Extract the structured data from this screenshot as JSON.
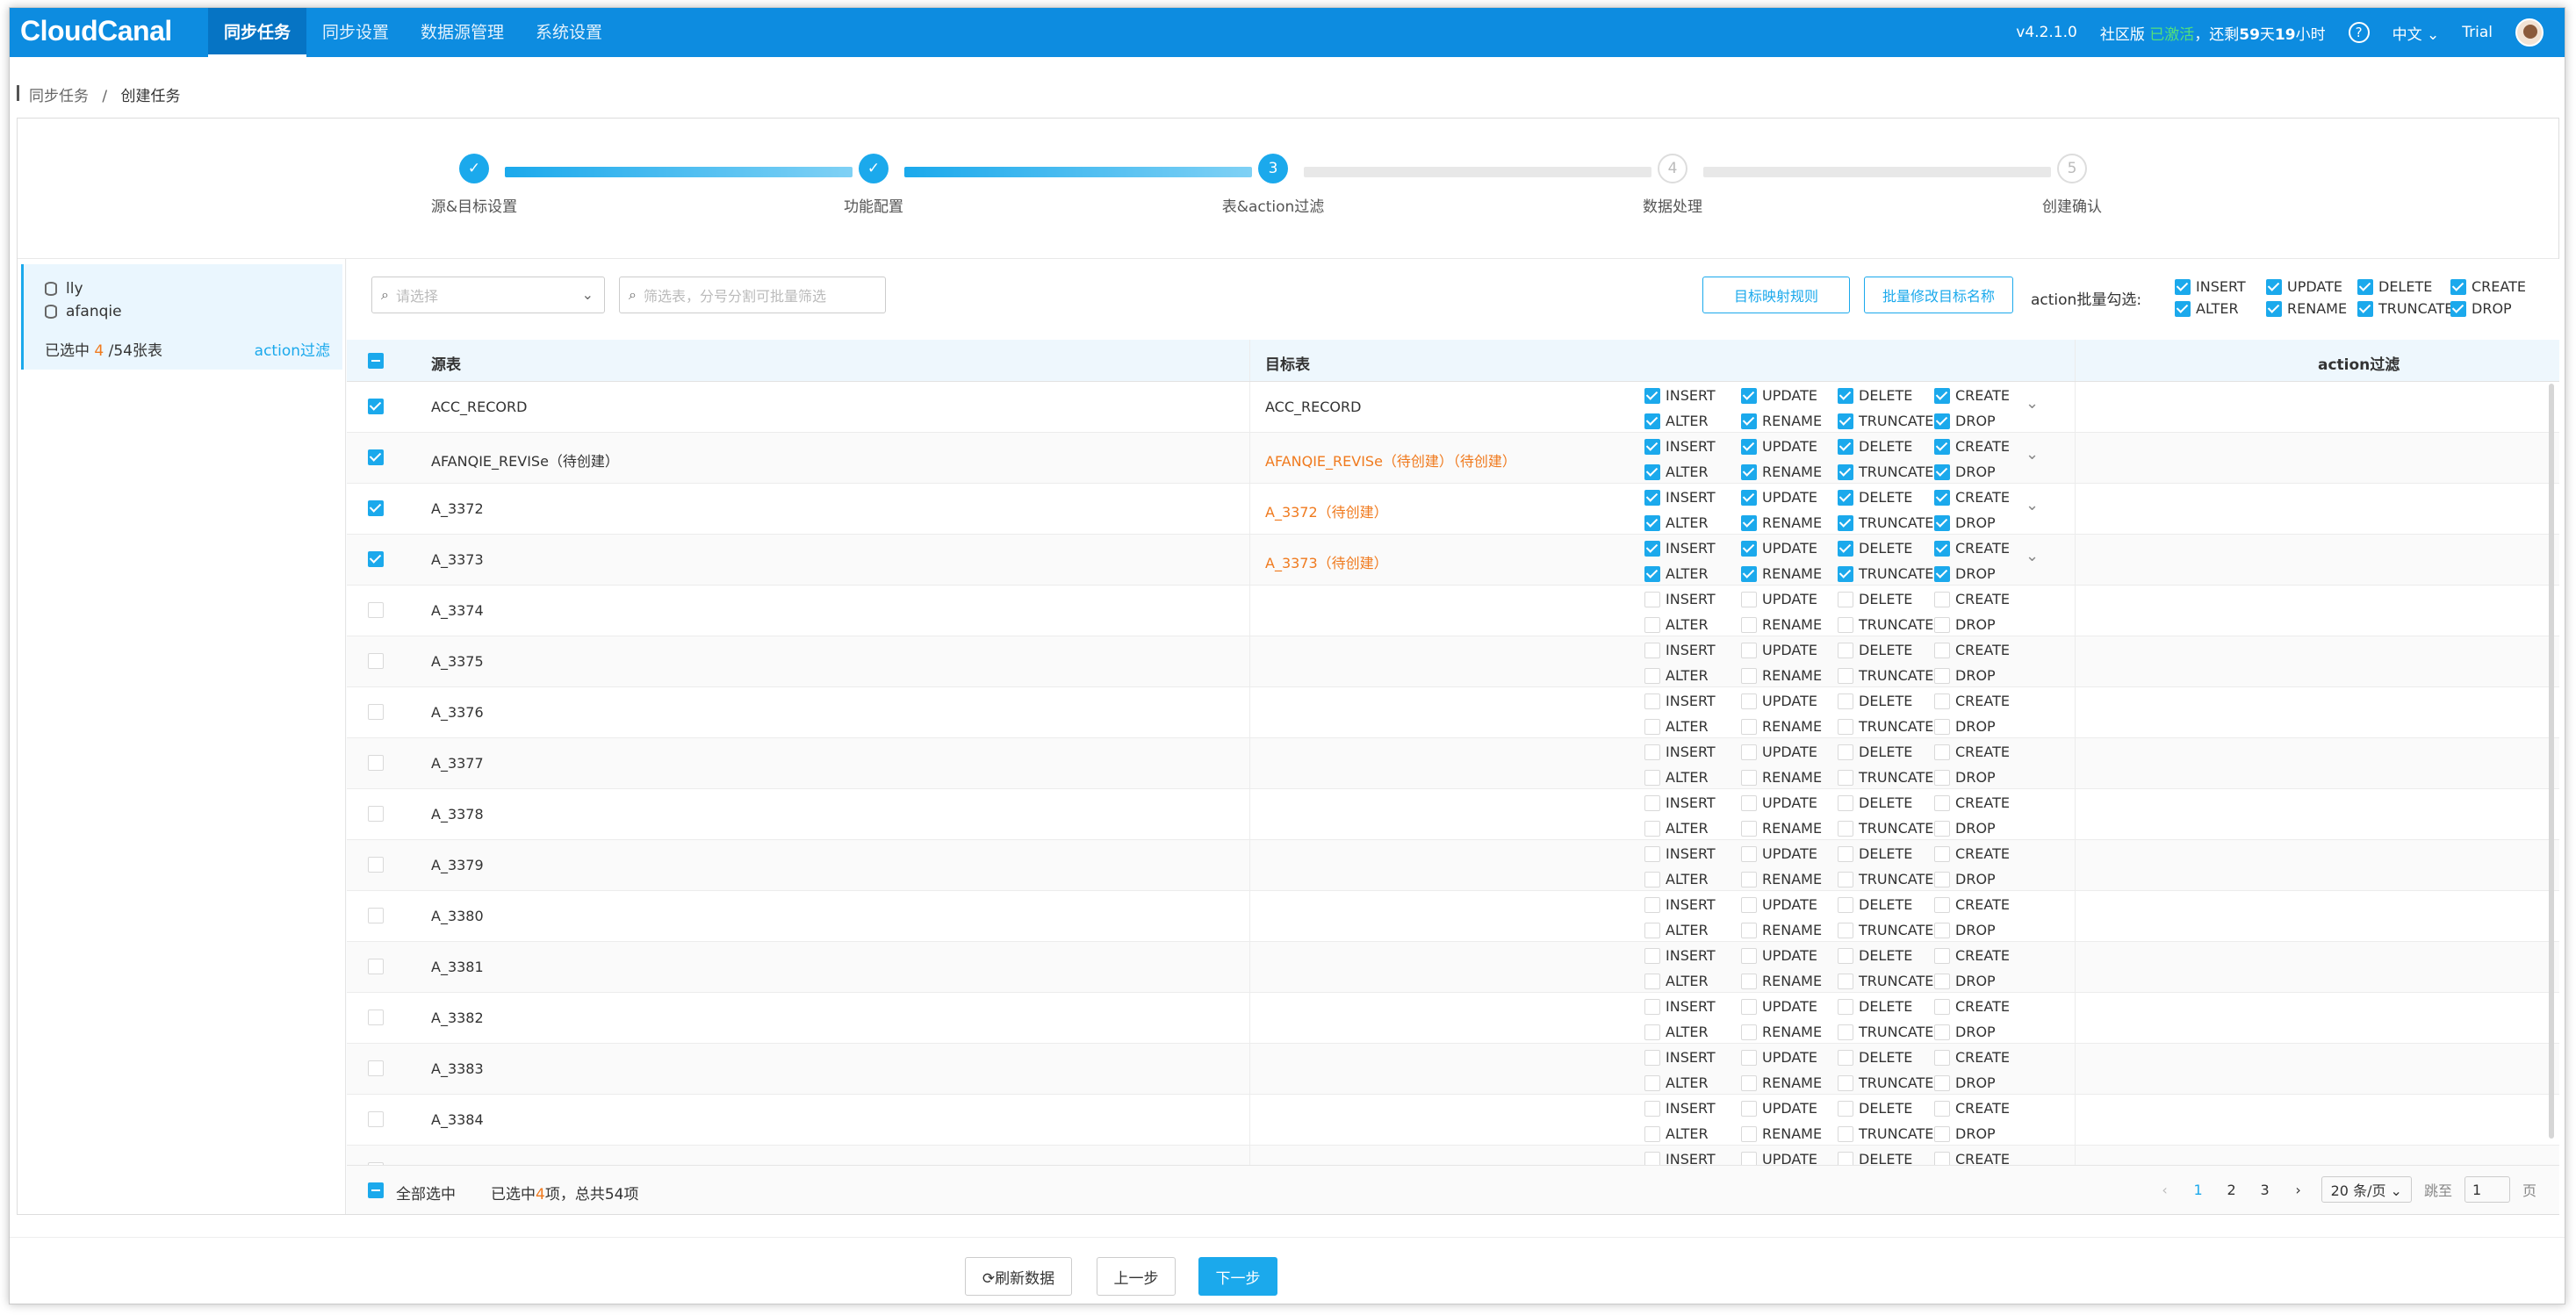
{
  "app": {
    "logo": "CloudCanal",
    "version": "v4.2.1.0",
    "edition_prefix": "社区版",
    "edition_status": "已激活",
    "remaining_prefix": "，还剩",
    "remaining_days": "59",
    "remaining_mid": "天",
    "remaining_hours": "19",
    "remaining_suffix": "小时",
    "help": "?",
    "language": "中文 ⌄",
    "user": "Trial"
  },
  "nav": [
    "同步任务",
    "同步设置",
    "数据源管理",
    "系统设置"
  ],
  "breadcrumb": {
    "parent": "同步任务",
    "sep": "/",
    "current": "创建任务"
  },
  "steps": [
    {
      "num": "✓",
      "label": "源&目标设置"
    },
    {
      "num": "✓",
      "label": "功能配置"
    },
    {
      "num": "3",
      "label": "表&action过滤"
    },
    {
      "num": "4",
      "label": "数据处理"
    },
    {
      "num": "5",
      "label": "创建确认"
    }
  ],
  "left": {
    "db1": "lly",
    "db2": "afanqie",
    "selected_prefix": "已选中",
    "selected_count": "4",
    "selected_suffix": "/54张表",
    "action_link": "action过滤"
  },
  "toolbar": {
    "select_placeholder": "请选择",
    "filter_placeholder": "筛选表，分号分割可批量筛选",
    "btn_mapping": "目标映射规则",
    "btn_rename": "批量修改目标名称",
    "batch_label": "action批量勾选:"
  },
  "actions": [
    "INSERT",
    "UPDATE",
    "DELETE",
    "CREATE",
    "ALTER",
    "RENAME",
    "TRUNCATE",
    "DROP"
  ],
  "table": {
    "headers": {
      "source": "源表",
      "target": "目标表",
      "action": "action过滤"
    },
    "rows": [
      {
        "source": "ACC_RECORD",
        "target": "ACC_RECORD",
        "checked": true,
        "pending": false
      },
      {
        "source": "AFANQIE_REVISe（待创建）",
        "target": "AFANQIE_REVISe（待创建）（待创建）",
        "checked": true,
        "pending": true
      },
      {
        "source": "A_3372",
        "target": "A_3372（待创建）",
        "checked": true,
        "pending": true
      },
      {
        "source": "A_3373",
        "target": "A_3373（待创建）",
        "checked": true,
        "pending": true
      },
      {
        "source": "A_3374",
        "target": "",
        "checked": false,
        "pending": false
      },
      {
        "source": "A_3375",
        "target": "",
        "checked": false,
        "pending": false
      },
      {
        "source": "A_3376",
        "target": "",
        "checked": false,
        "pending": false
      },
      {
        "source": "A_3377",
        "target": "",
        "checked": false,
        "pending": false
      },
      {
        "source": "A_3378",
        "target": "",
        "checked": false,
        "pending": false
      },
      {
        "source": "A_3379",
        "target": "",
        "checked": false,
        "pending": false
      },
      {
        "source": "A_3380",
        "target": "",
        "checked": false,
        "pending": false
      },
      {
        "source": "A_3381",
        "target": "",
        "checked": false,
        "pending": false
      },
      {
        "source": "A_3382",
        "target": "",
        "checked": false,
        "pending": false
      },
      {
        "source": "A_3383",
        "target": "",
        "checked": false,
        "pending": false
      },
      {
        "source": "A_3384",
        "target": "",
        "checked": false,
        "pending": false
      },
      {
        "source": "",
        "target": "",
        "checked": false,
        "pending": false
      }
    ]
  },
  "footer": {
    "select_all": "全部选中",
    "summary_prefix": "已选中",
    "summary_count": "4",
    "summary_mid": "项，总共",
    "summary_total": "54",
    "summary_suffix": "项"
  },
  "pager": {
    "prev": "‹",
    "pages": [
      "1",
      "2",
      "3"
    ],
    "next": "›",
    "size": "20 条/页 ⌄",
    "jump_label": "跳至",
    "jump_value": "1",
    "page_suffix": "页"
  },
  "bottom": {
    "refresh": "⟳刷新数据",
    "prev": "上一步",
    "next": "下一步"
  },
  "colors": {
    "primary": "#1ba9ec",
    "topbar": "#0d8ce0",
    "pending": "#f07a1e",
    "active_green": "#52e07a"
  }
}
